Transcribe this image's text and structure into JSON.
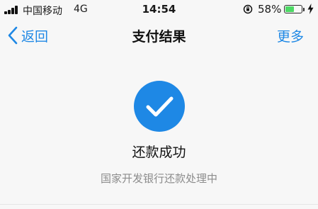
{
  "status_bar": {
    "carrier": "中国移动",
    "network": "4G",
    "time": "14:54",
    "battery_percent": "58%",
    "battery_level": 0.58,
    "battery_color": "#4cd964",
    "icons": [
      "signal-bars-icon",
      "orientation-lock-icon",
      "battery-icon",
      "charging-bolt-icon"
    ]
  },
  "nav": {
    "back_label": "返回",
    "title": "支付结果",
    "more_label": "更多",
    "accent_color": "#1e88e5"
  },
  "result": {
    "icon": "checkmark-circle-icon",
    "title": "还款成功",
    "subtitle": "国家开发银行还款处理中"
  }
}
